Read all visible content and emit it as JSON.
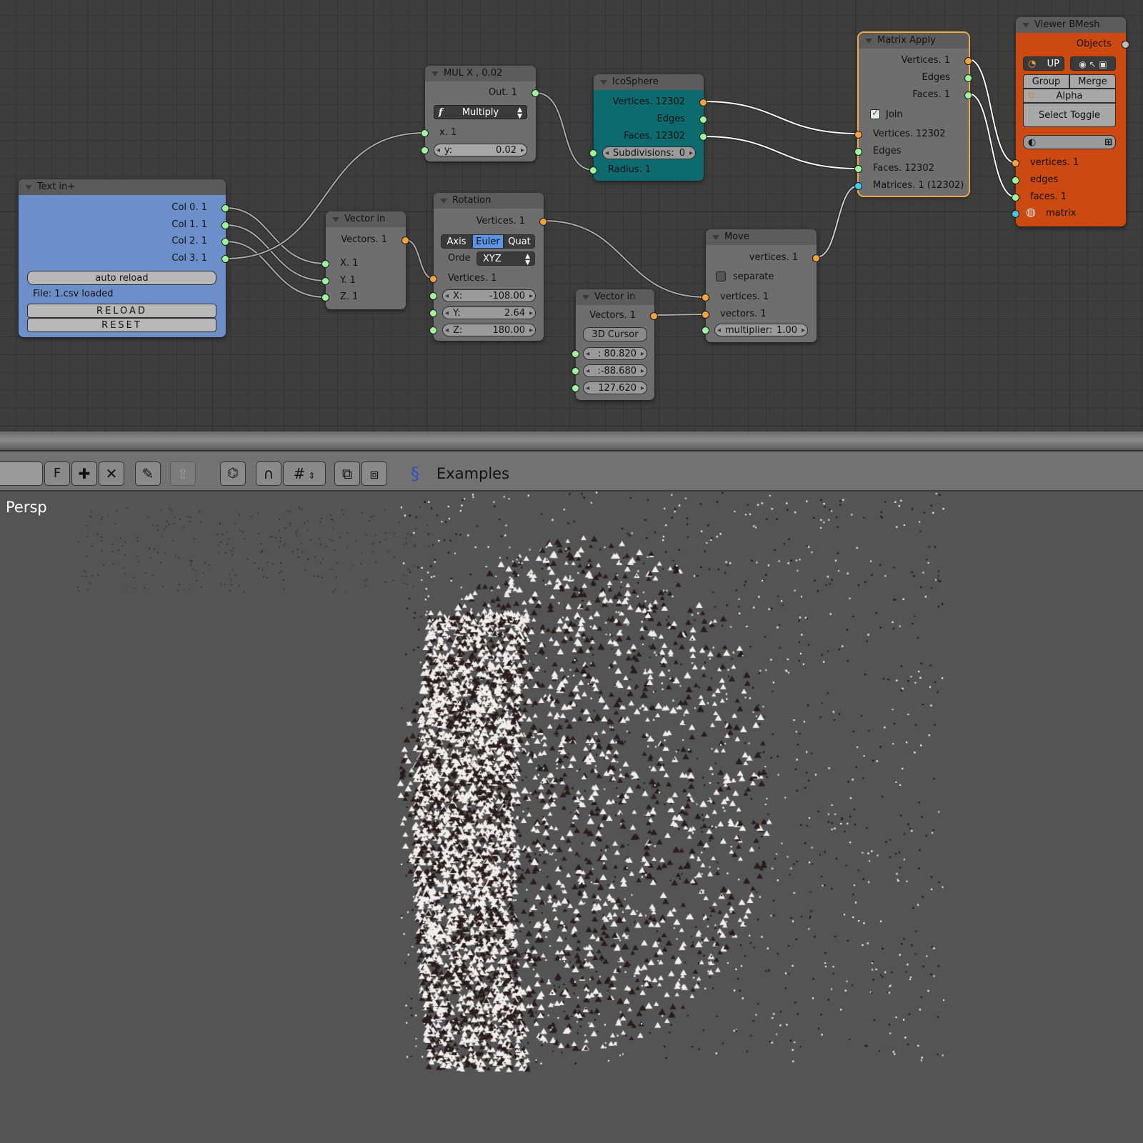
{
  "colors": {
    "text_in_node": "#6c8fc9",
    "icosphere_node": "#0d6a6e",
    "viewer_node": "#cc4a12",
    "socket_green": "#9ef59b",
    "socket_orange": "#f4a23d",
    "socket_cyan": "#45c8e8",
    "selection_outline": "#f3a64a"
  },
  "nodes": {
    "text_in": {
      "title": "Text in+",
      "outputs": [
        "Col 0. 1",
        "Col 1. 1",
        "Col 2. 1",
        "Col 3. 1"
      ],
      "auto_reload": "auto reload",
      "file_status": "File: 1.csv loaded",
      "reload": "RELOAD",
      "reset": "RESET"
    },
    "vector_in_1": {
      "title": "Vector in",
      "output": "Vectors. 1",
      "inputs": [
        "X. 1",
        "Y. 1",
        "Z. 1"
      ]
    },
    "mul": {
      "title": "MUL X ,  0.02",
      "output": "Out. 1",
      "function_icon": "f",
      "operation": "Multiply",
      "input_x": "x. 1",
      "y_label": "y:",
      "y_value": "0.02"
    },
    "rotation": {
      "title": "Rotation",
      "output": "Vertices. 1",
      "modes": [
        "Axis",
        "Euler",
        "Quat"
      ],
      "active_mode": "Euler",
      "order_label": "Orde",
      "order_value": "XYZ",
      "input_vertices": "Vertices. 1",
      "x_label": "X:",
      "x_value": "-108.00",
      "y_label": "Y:",
      "y_value": "2.64",
      "z_label": "Z:",
      "z_value": "180.00"
    },
    "icosphere": {
      "title": "IcoSphere",
      "outputs": [
        "Vertices. 12302",
        "Edges",
        "Faces. 12302"
      ],
      "subdivisions_label": "Subdivisions:",
      "subdivisions_value": "0",
      "radius": "Radius. 1"
    },
    "vector_in_2": {
      "title": "Vector in",
      "output": "Vectors. 1",
      "cursor_button": "3D Cursor",
      "values": [
        ": 80.820",
        ":-88.680",
        "127.620"
      ]
    },
    "move": {
      "title": "Move",
      "output": "vertices. 1",
      "separate": "separate",
      "inputs": [
        "vertices. 1",
        "vectors. 1"
      ],
      "multiplier_label": "multiplier:",
      "multiplier_value": "1.00"
    },
    "matrix_apply": {
      "title": "Matrix Apply",
      "outputs": [
        "Vertices. 1",
        "Edges",
        "Faces. 1"
      ],
      "join": "Join",
      "inputs": [
        "Vertices. 12302",
        "Edges",
        "Faces. 12302",
        "Matrices. 1 (12302)"
      ]
    },
    "viewer": {
      "title": "Viewer BMesh",
      "objects": "Objects",
      "up": "UP",
      "group": "Group",
      "merge": "Merge",
      "alpha": "Alpha",
      "select_toggle": "Select Toggle",
      "inputs": [
        "vertices. 1",
        "edges",
        "faces. 1",
        "matrix"
      ]
    }
  },
  "toolbar": {
    "f_button": "F",
    "icons": [
      "plus-icon",
      "close-icon",
      "pin-icon",
      "up-arrow-icon",
      "node-tree-icon",
      "snap-magnet-icon",
      "grid-snap-icon",
      "copy-icon",
      "paste-icon",
      "sverchok-icon"
    ],
    "examples_label": "Examples"
  },
  "viewport": {
    "label": "Persp"
  }
}
